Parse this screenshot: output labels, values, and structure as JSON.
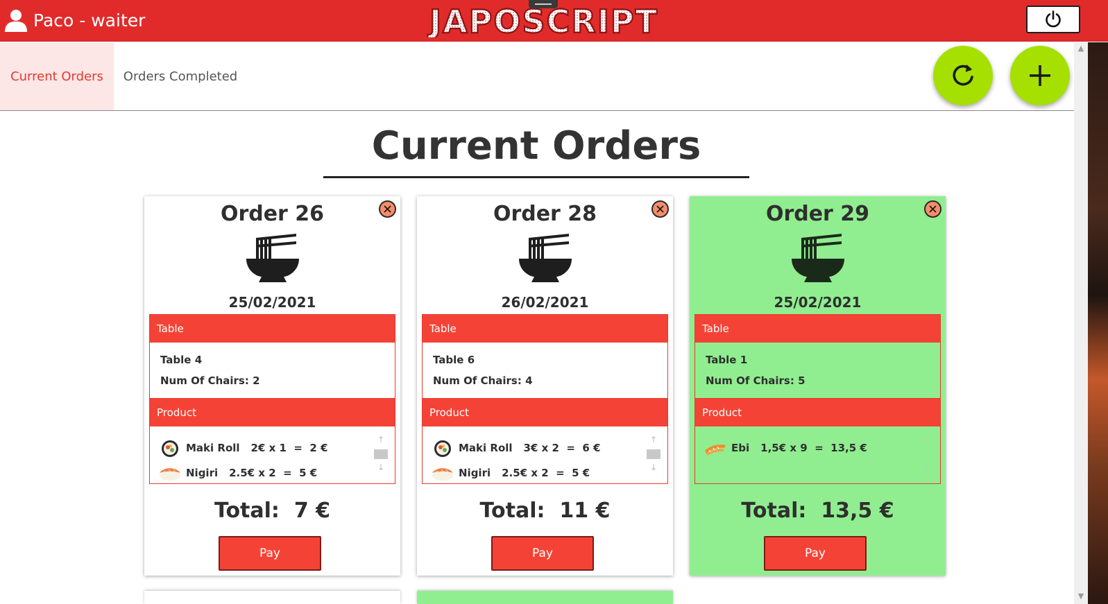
{
  "header": {
    "user_label": "Paco - waiter",
    "logo_text": "JAPOSCRIPT"
  },
  "tabs": [
    {
      "label": "Current Orders",
      "active": true
    },
    {
      "label": "Orders Completed",
      "active": false
    }
  ],
  "page_title": "Current Orders",
  "labels": {
    "table_section": "Table",
    "product_section": "Product",
    "pay_button": "Pay"
  },
  "orders": [
    {
      "title": "Order 26",
      "date": "25/02/2021",
      "table": "Table 4",
      "chairs": "Num Of Chairs: 2",
      "products": [
        {
          "name": "Maki Roll",
          "calc": "2€ x 1  =  2 €",
          "image": "maki-roll"
        },
        {
          "name": "Nigiri",
          "calc": "2.5€ x 2  =  5 €",
          "image": "nigiri"
        }
      ],
      "total": "Total:  7 €",
      "completed": false
    },
    {
      "title": "Order 28",
      "date": "26/02/2021",
      "table": "Table 6",
      "chairs": "Num Of Chairs: 4",
      "products": [
        {
          "name": "Maki Roll",
          "calc": "3€ x 2  =  6 €",
          "image": "maki-roll"
        },
        {
          "name": "Nigiri",
          "calc": "2.5€ x 2  =  5 €",
          "image": "nigiri"
        }
      ],
      "total": "Total:  11 €",
      "completed": false
    },
    {
      "title": "Order 29",
      "date": "25/02/2021",
      "table": "Table 1",
      "chairs": "Num Of Chairs: 5",
      "products": [
        {
          "name": "Ebi",
          "calc": "1,5€ x 9  =  13,5 €",
          "image": "ebi"
        }
      ],
      "total": "Total:  13,5 €",
      "completed": true
    }
  ],
  "colors": {
    "header_red": "#e12b2b",
    "accent_red": "#f44336",
    "fab_green": "#a6e000",
    "completed_green": "#90ee90",
    "active_tab_bg": "#fde6e6"
  },
  "icons": [
    "user-icon",
    "power-icon",
    "refresh-icon",
    "plus-icon",
    "close-icon",
    "noodle-bowl-icon"
  ]
}
